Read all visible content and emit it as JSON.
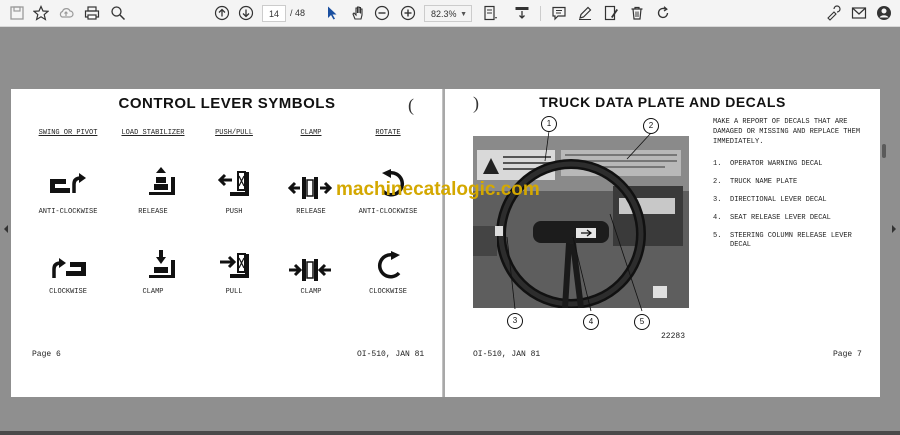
{
  "toolbar": {
    "page_current": "14",
    "page_total": "/ 48",
    "zoom": "82.3%"
  },
  "left_page": {
    "title": "CONTROL LEVER SYMBOLS",
    "categories": [
      "SWING OR PIVOT",
      "LOAD STABILIZER",
      "PUSH/PULL",
      "CLAMP",
      "ROTATE"
    ],
    "row1_labels": [
      "ANTI-CLOCKWISE",
      "RELEASE",
      "PUSH",
      "RELEASE",
      "ANTI-CLOCKWISE"
    ],
    "row2_labels": [
      "CLOCKWISE",
      "CLAMP",
      "PULL",
      "CLAMP",
      "CLOCKWISE"
    ],
    "footer_left": "Page 6",
    "footer_right": "OI-510, JAN 81"
  },
  "right_page": {
    "title": "TRUCK DATA PLATE AND DECALS",
    "report_text": "MAKE A REPORT OF DECALS THAT ARE DAMAGED OR MISSING AND REPLACE THEM IMMEDIATELY.",
    "items": [
      {
        "num": "1.",
        "text": "OPERATOR WARNING DECAL"
      },
      {
        "num": "2.",
        "text": "TRUCK NAME PLATE"
      },
      {
        "num": "3.",
        "text": "DIRECTIONAL LEVER DECAL"
      },
      {
        "num": "4.",
        "text": "SEAT RELEASE LEVER DECAL"
      },
      {
        "num": "5.",
        "text": "STEERING COLUMN RELEASE LEVER DECAL"
      }
    ],
    "callouts": [
      "1",
      "2",
      "3",
      "4",
      "5"
    ],
    "figure_number": "22283",
    "footer_left": "OI-510, JAN 81",
    "footer_right": "Page 7"
  },
  "watermark": "machinecatalogic.com",
  "colors": {
    "viewer_bg": "#8f8f8f",
    "toolbar_bg": "#f4f4f4",
    "watermark": "#d4a800"
  }
}
